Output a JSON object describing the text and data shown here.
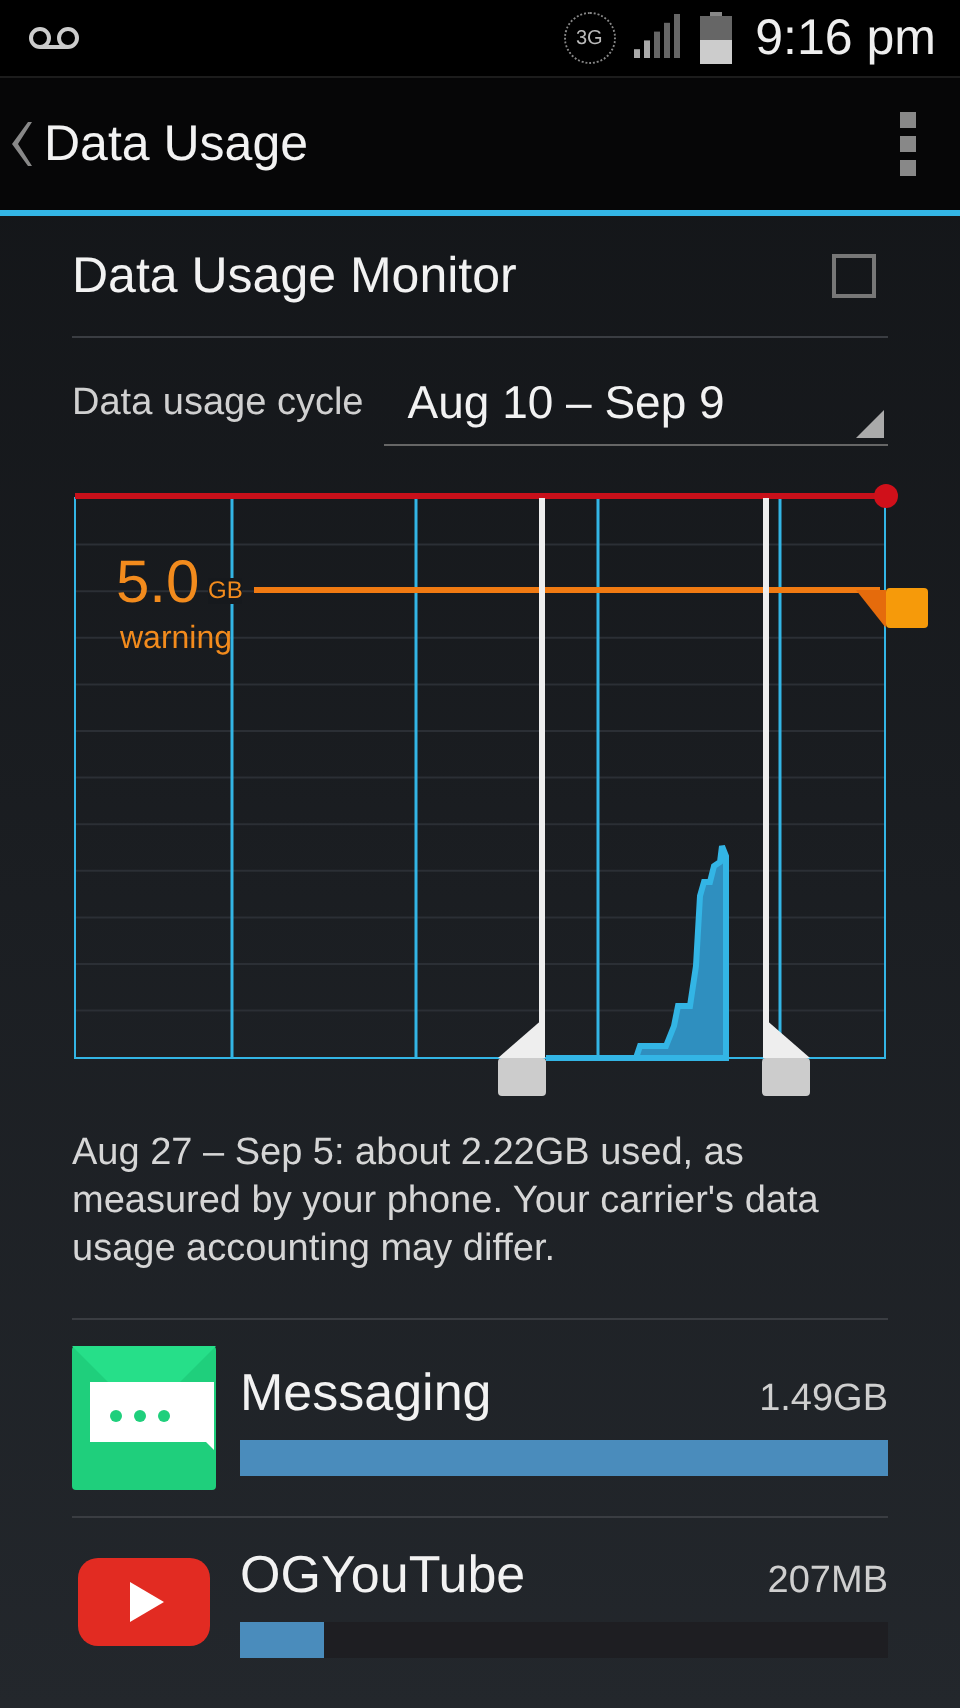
{
  "status_bar": {
    "network": "3G",
    "time": "9:16 pm"
  },
  "action_bar": {
    "title": "Data Usage"
  },
  "monitor": {
    "label": "Data Usage Monitor",
    "checked": false
  },
  "cycle": {
    "label": "Data usage cycle",
    "value": "Aug 10 – Sep 9"
  },
  "chart": {
    "warning_value": "5.0",
    "warning_unit": "GB",
    "warning_label": "warning"
  },
  "summary": "Aug 27 – Sep 5: about 2.22GB used, as measured by your phone. Your carrier's data usage accounting may differ.",
  "apps": [
    {
      "kind": "messaging",
      "name": "Messaging",
      "usage": "1.49GB",
      "level": 1.0
    },
    {
      "kind": "video",
      "name": "OGYouTube",
      "usage": "207MB",
      "level": 0.13
    }
  ]
}
